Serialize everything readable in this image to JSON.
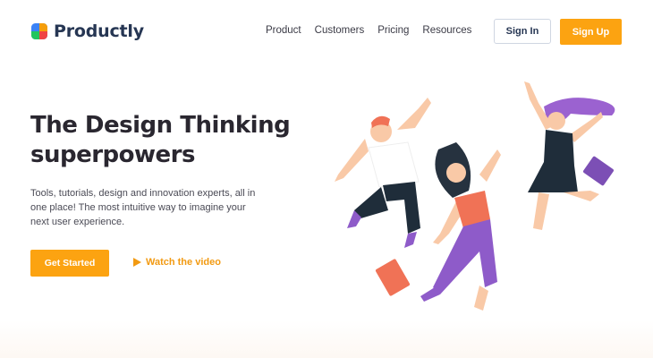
{
  "header": {
    "brand": "Productly",
    "nav": [
      "Product",
      "Customers",
      "Pricing",
      "Resources"
    ],
    "signin_label": "Sign In",
    "signup_label": "Sign Up"
  },
  "hero": {
    "title_line1": "The Design Thinking",
    "title_line2": "superpowers",
    "description": "Tools, tutorials, design and innovation experts, all in one place! The most intuitive way to imagine your next user experience.",
    "cta_label": "Get Started",
    "video_label": "Watch the video"
  },
  "colors": {
    "accent": "#fca311",
    "brand_text": "#263653",
    "heading": "#2a2730",
    "purple": "#8e5bc9",
    "coral": "#f07256"
  },
  "icons": [
    "logo-mark-icon",
    "play-icon"
  ]
}
